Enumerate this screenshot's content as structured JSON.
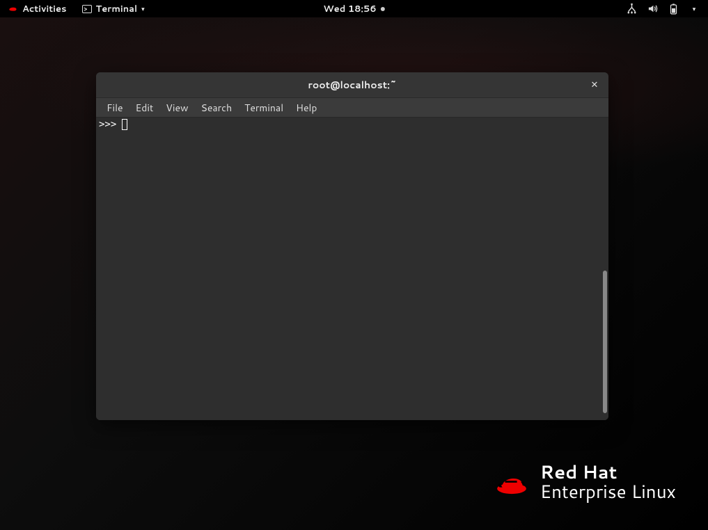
{
  "topbar": {
    "activities": "Activities",
    "app_name": "Terminal",
    "datetime": "Wed 18:56"
  },
  "window": {
    "title": "root@localhost:~",
    "menubar": {
      "file": "File",
      "edit": "Edit",
      "view": "View",
      "search": "Search",
      "terminal": "Terminal",
      "help": "Help"
    },
    "prompt": ">>>"
  },
  "branding": {
    "line1": "Red Hat",
    "line2": "Enterprise Linux"
  }
}
